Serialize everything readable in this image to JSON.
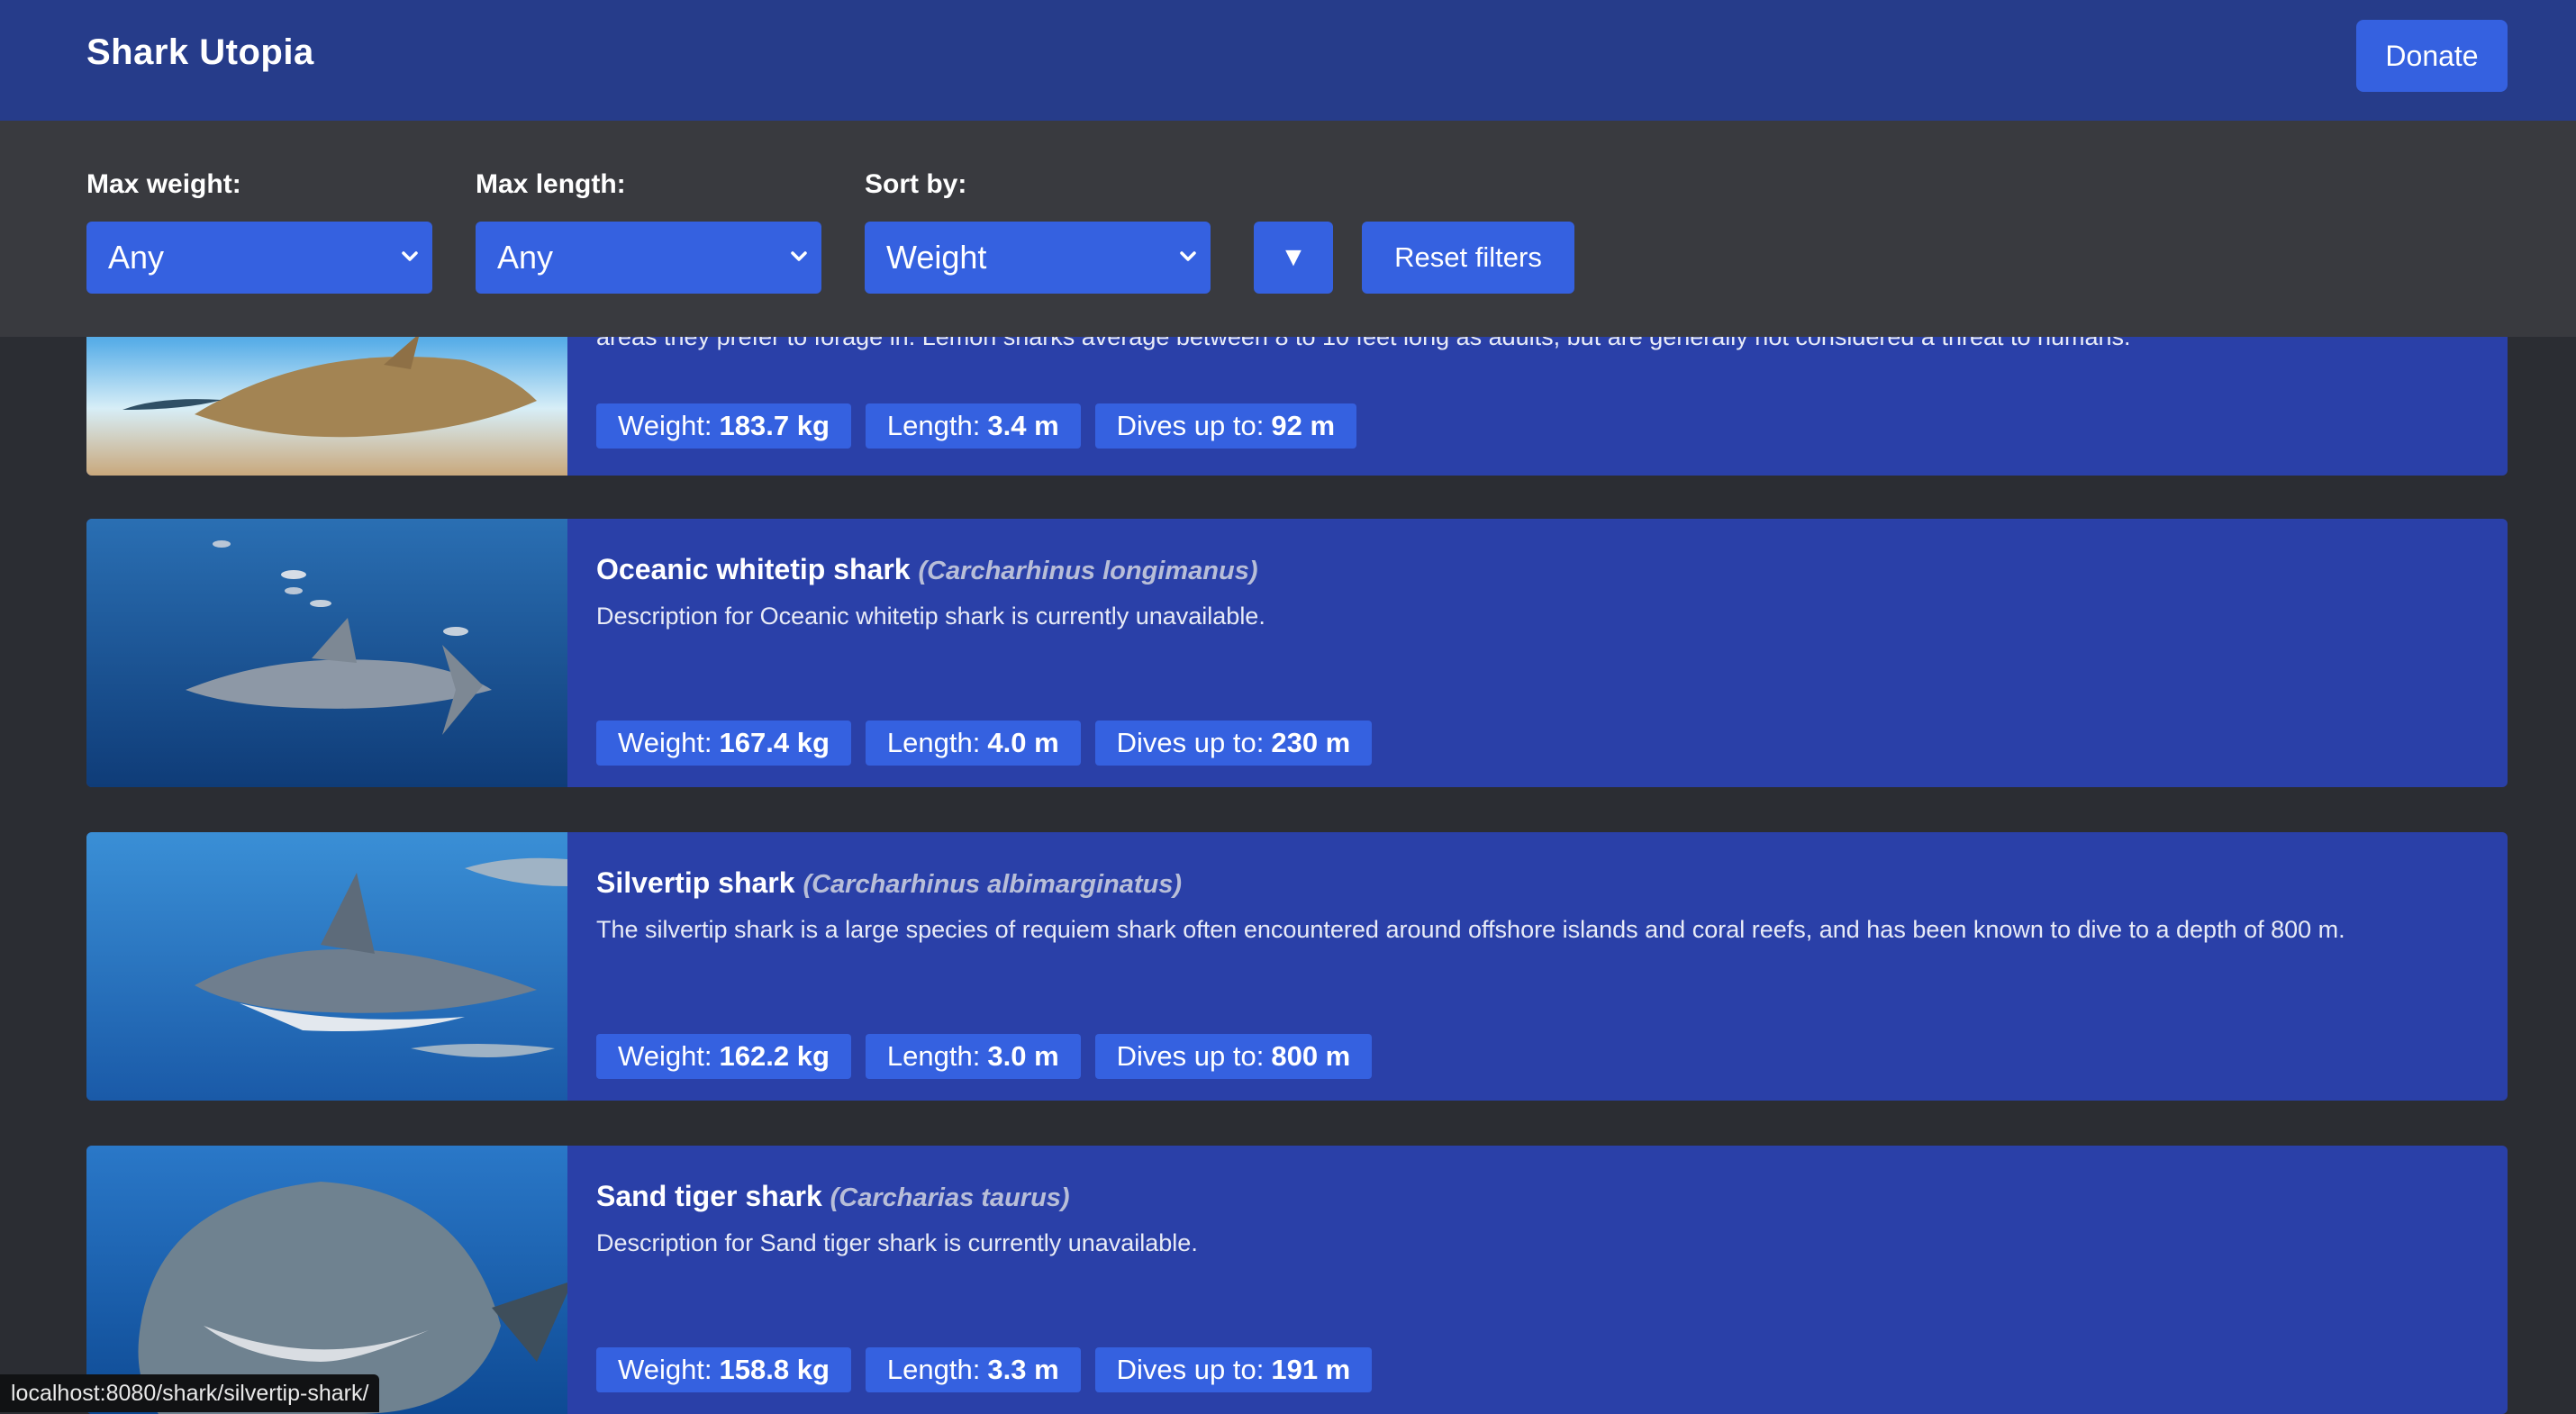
{
  "header": {
    "brand": "Shark Utopia",
    "donate_label": "Donate"
  },
  "filters": {
    "max_weight": {
      "label": "Max weight:",
      "value": "Any"
    },
    "max_length": {
      "label": "Max length:",
      "value": "Any"
    },
    "sort_by": {
      "label": "Sort by:",
      "value": "Weight"
    },
    "sort_direction_glyph": "▼",
    "reset_label": "Reset filters"
  },
  "sharks": [
    {
      "name": "",
      "scientific": "",
      "description": "areas they prefer to forage in. Lemon sharks average between 8 to 10 feet long as adults, but are generally not considered a threat to humans.",
      "weight_label": "Weight:",
      "weight": "183.7 kg",
      "length_label": "Length:",
      "length": "3.4 m",
      "dive_label": "Dives up to:",
      "dive": "92 m"
    },
    {
      "name": "Oceanic whitetip shark",
      "scientific": "(Carcharhinus longimanus)",
      "description": "Description for Oceanic whitetip shark is currently unavailable.",
      "weight_label": "Weight:",
      "weight": "167.4 kg",
      "length_label": "Length:",
      "length": "4.0 m",
      "dive_label": "Dives up to:",
      "dive": "230 m"
    },
    {
      "name": "Silvertip shark",
      "scientific": "(Carcharhinus albimarginatus)",
      "description": "The silvertip shark is a large species of requiem shark often encountered around offshore islands and coral reefs, and has been known to dive to a depth of 800 m.",
      "weight_label": "Weight:",
      "weight": "162.2 kg",
      "length_label": "Length:",
      "length": "3.0 m",
      "dive_label": "Dives up to:",
      "dive": "800 m"
    },
    {
      "name": "Sand tiger shark",
      "scientific": "(Carcharias taurus)",
      "description": "Description for Sand tiger shark is currently unavailable.",
      "weight_label": "Weight:",
      "weight": "158.8 kg",
      "length_label": "Length:",
      "length": "3.3 m",
      "dive_label": "Dives up to:",
      "dive": "191 m"
    }
  ],
  "status_url": "localhost:8080/shark/silvertip-shark/"
}
